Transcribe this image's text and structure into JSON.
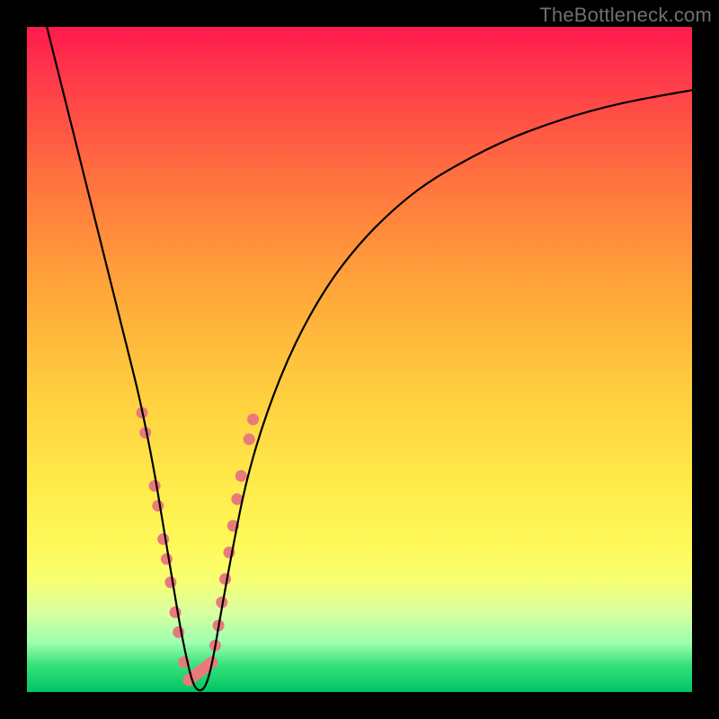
{
  "watermark": "TheBottleneck.com",
  "colors": {
    "frame": "#000000",
    "gradient_top": "#ff1a4d",
    "gradient_bottom": "#00c463",
    "curve": "#000000",
    "marker": "#e97a7c"
  },
  "chart_data": {
    "type": "line",
    "title": "",
    "xlabel": "",
    "ylabel": "",
    "xlim": [
      0,
      100
    ],
    "ylim": [
      0,
      100
    ],
    "x": [
      3,
      5,
      7,
      9,
      11,
      13,
      15,
      17,
      19,
      20,
      21,
      22,
      23,
      24,
      25,
      26,
      27,
      28,
      29,
      31,
      33,
      36,
      40,
      45,
      50,
      55,
      60,
      66,
      72,
      78,
      84,
      90,
      96,
      100
    ],
    "y": [
      100,
      92,
      84,
      76,
      68,
      60,
      52,
      44,
      34,
      28,
      22,
      16,
      10,
      5,
      1,
      0,
      1,
      5,
      11,
      22,
      32,
      42,
      52,
      61,
      67.5,
      72.5,
      76.5,
      80,
      83,
      85.3,
      87.2,
      88.7,
      89.8,
      90.5
    ],
    "series": [
      {
        "name": "bottleneck-curve",
        "x_ref": "x",
        "y_ref": "y"
      }
    ],
    "markers": {
      "note": "salmon point/pill markers near the valley region",
      "points_xy": [
        [
          17.3,
          42
        ],
        [
          17.8,
          39
        ],
        [
          19.2,
          31
        ],
        [
          19.7,
          28
        ],
        [
          20.5,
          23
        ],
        [
          21.0,
          20
        ],
        [
          21.6,
          16.5
        ],
        [
          22.3,
          12
        ],
        [
          22.8,
          9
        ],
        [
          23.6,
          4.5
        ],
        [
          24.3,
          1.8
        ],
        [
          25.3,
          0.4
        ],
        [
          26.3,
          0.6
        ],
        [
          27.2,
          2.2
        ],
        [
          27.8,
          4.5
        ],
        [
          28.3,
          7
        ],
        [
          28.8,
          10
        ],
        [
          29.3,
          13.5
        ],
        [
          29.8,
          17
        ],
        [
          30.4,
          21
        ],
        [
          31.0,
          25
        ],
        [
          31.6,
          29
        ],
        [
          32.2,
          32.5
        ],
        [
          33.4,
          38
        ],
        [
          34.0,
          41
        ]
      ]
    }
  }
}
